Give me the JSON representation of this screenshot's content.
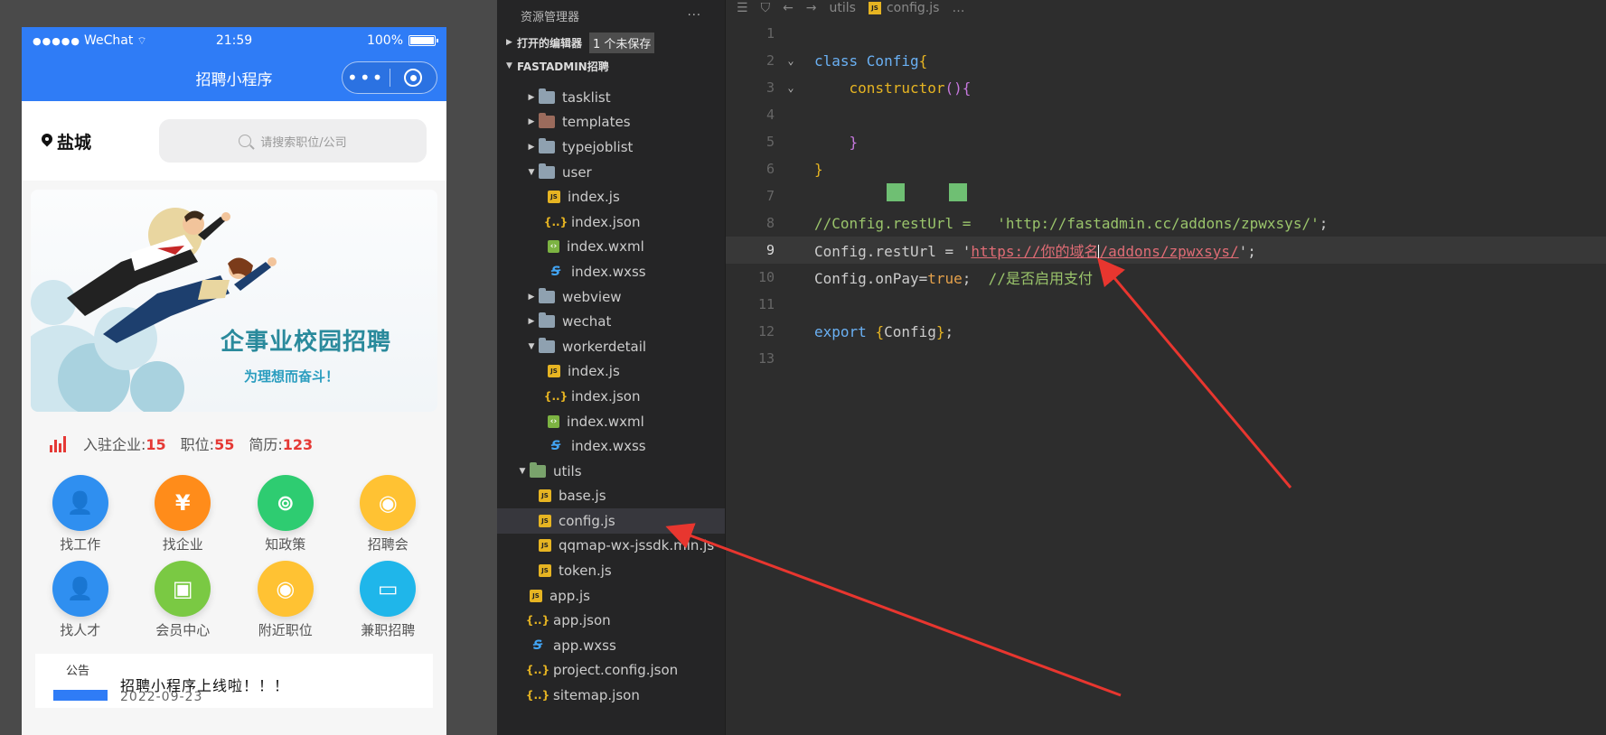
{
  "phone": {
    "status": {
      "signal": "●●●●●",
      "carrier": "WeChat",
      "time": "21:59",
      "battery": "100%"
    },
    "nav_title": "招聘小程序",
    "city": "盐城",
    "search_placeholder": "请搜索职位/公司",
    "banner": {
      "title": "企事业校园招聘",
      "subtitle": "为理想而奋斗！"
    },
    "stats": [
      {
        "label": "入驻企业:",
        "value": "15"
      },
      {
        "label": "职位:",
        "value": "55"
      },
      {
        "label": "简历:",
        "value": "123"
      }
    ],
    "grid": [
      {
        "label": "找工作",
        "color": "#2f8ff0",
        "icon": "person-icon"
      },
      {
        "label": "找企业",
        "color": "#ff8c1a",
        "icon": "yen-icon"
      },
      {
        "label": "知政策",
        "color": "#2ecc71",
        "icon": "signal-icon"
      },
      {
        "label": "招聘会",
        "color": "#ffc233",
        "icon": "location-icon"
      },
      {
        "label": "找人才",
        "color": "#2f8ff0",
        "icon": "person-icon"
      },
      {
        "label": "会员中心",
        "color": "#7ac943",
        "icon": "contact-book-icon"
      },
      {
        "label": "附近职位",
        "color": "#ffc233",
        "icon": "location-icon"
      },
      {
        "label": "兼职招聘",
        "color": "#1fb6ea",
        "icon": "briefcase-icon"
      }
    ],
    "notice": {
      "tag": "公告",
      "text": "招聘小程序上线啦！！！",
      "date": "2022-09-23"
    }
  },
  "explorer": {
    "header": "资源管理器",
    "more": "···",
    "open_editors": "打开的编辑器",
    "unsaved_badge": "1 个未保存",
    "project": "FASTADMIN招聘",
    "tree": [
      {
        "name": "tasklist",
        "type": "folder",
        "depth": 1,
        "open": false
      },
      {
        "name": "templates",
        "type": "folder-brown",
        "depth": 1,
        "open": false
      },
      {
        "name": "typejoblist",
        "type": "folder",
        "depth": 1,
        "open": false
      },
      {
        "name": "user",
        "type": "folder",
        "depth": 1,
        "open": true
      },
      {
        "name": "index.js",
        "type": "js",
        "depth": 2
      },
      {
        "name": "index.json",
        "type": "json",
        "depth": 2
      },
      {
        "name": "index.wxml",
        "type": "wxml",
        "depth": 2
      },
      {
        "name": "index.wxss",
        "type": "wxss",
        "depth": 2
      },
      {
        "name": "webview",
        "type": "folder",
        "depth": 1,
        "open": false
      },
      {
        "name": "wechat",
        "type": "folder",
        "depth": 1,
        "open": false
      },
      {
        "name": "workerdetail",
        "type": "folder",
        "depth": 1,
        "open": true
      },
      {
        "name": "index.js",
        "type": "js",
        "depth": 2
      },
      {
        "name": "index.json",
        "type": "json",
        "depth": 2
      },
      {
        "name": "index.wxml",
        "type": "wxml",
        "depth": 2
      },
      {
        "name": "index.wxss",
        "type": "wxss",
        "depth": 2
      },
      {
        "name": "utils",
        "type": "folder-green",
        "depth": 0,
        "open": true
      },
      {
        "name": "base.js",
        "type": "js",
        "depth": 1
      },
      {
        "name": "config.js",
        "type": "js",
        "depth": 1,
        "selected": true
      },
      {
        "name": "qqmap-wx-jssdk.min.js",
        "type": "js",
        "depth": 1
      },
      {
        "name": "token.js",
        "type": "js",
        "depth": 1
      },
      {
        "name": "app.js",
        "type": "js",
        "depth": 0
      },
      {
        "name": "app.json",
        "type": "json",
        "depth": 0
      },
      {
        "name": "app.wxss",
        "type": "wxss",
        "depth": 0
      },
      {
        "name": "project.config.json",
        "type": "json",
        "depth": 0
      },
      {
        "name": "sitemap.json",
        "type": "json",
        "depth": 0
      }
    ]
  },
  "editor": {
    "breadcrumb": [
      "utils",
      "config.js",
      "…"
    ],
    "current_line": 9,
    "lines": [
      {
        "n": "1",
        "tokens": []
      },
      {
        "n": "2",
        "fold": true,
        "tokens": [
          [
            "kw",
            "class "
          ],
          [
            "cls",
            "Config"
          ],
          [
            "br",
            "{"
          ]
        ]
      },
      {
        "n": "3",
        "fold": true,
        "tokens": [
          [
            "",
            "    "
          ],
          [
            "fn",
            "constructor"
          ],
          [
            "br2",
            "(){"
          ]
        ]
      },
      {
        "n": "4",
        "tokens": []
      },
      {
        "n": "5",
        "tokens": [
          [
            "",
            "    "
          ],
          [
            "br2",
            "}"
          ]
        ]
      },
      {
        "n": "6",
        "tokens": [
          [
            "br",
            "}"
          ]
        ]
      },
      {
        "n": "7",
        "tokens": []
      },
      {
        "n": "8",
        "tokens": [
          [
            "cm",
            "//Config.restUrl =   "
          ],
          [
            "cm",
            "'http://fastadmin.cc/addons/zpwxsys/'"
          ],
          [
            "",
            ";"
          ]
        ]
      },
      {
        "n": "9",
        "tokens": [
          [
            "",
            "Config.restUrl = '"
          ],
          [
            "url",
            "https://你的域名"
          ],
          [
            "cursor",
            ""
          ],
          [
            "url",
            "/addons/zpwxsys/"
          ],
          [
            "",
            "';"
          ]
        ]
      },
      {
        "n": "10",
        "tokens": [
          [
            "",
            "Config.onPay="
          ],
          [
            "bool",
            "true"
          ],
          [
            "",
            ";  "
          ],
          [
            "cm",
            "//是否启用支付"
          ]
        ]
      },
      {
        "n": "11",
        "tokens": []
      },
      {
        "n": "12",
        "tokens": [
          [
            "kw",
            "export "
          ],
          [
            "br",
            "{"
          ],
          [
            "",
            "Config"
          ],
          [
            "br",
            "}"
          ],
          [
            "",
            ";"
          ]
        ]
      },
      {
        "n": "13",
        "tokens": []
      }
    ]
  },
  "annotations": {
    "arrow_color": "#e8362f"
  }
}
